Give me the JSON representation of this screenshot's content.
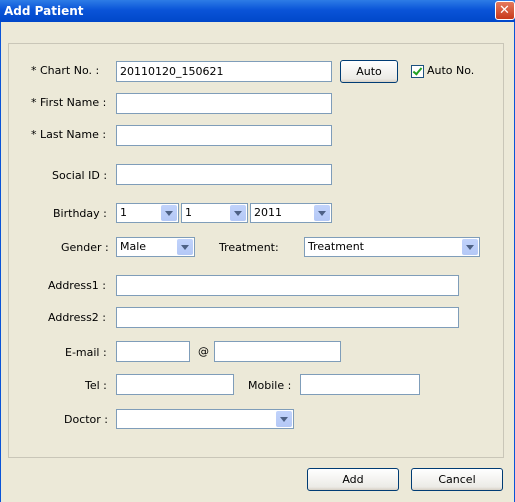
{
  "window": {
    "title": "Add Patient",
    "close_glyph": "✕",
    "close_icon": "close-icon"
  },
  "form": {
    "chart_no": {
      "label": "* Chart No. :",
      "value": "20110120_150621"
    },
    "auto_button": "Auto",
    "auto_no": {
      "label": "Auto No.",
      "checked": true
    },
    "first_name": {
      "label": "* First Name :",
      "value": ""
    },
    "last_name": {
      "label": "* Last Name :",
      "value": ""
    },
    "social_id": {
      "label": "Social ID :",
      "value": ""
    },
    "birthday": {
      "label": "Birthday :",
      "day": "1",
      "month": "1",
      "year": "2011"
    },
    "gender": {
      "label": "Gender :",
      "value": "Male"
    },
    "treatment": {
      "label": "Treatment:",
      "value": "Treatment"
    },
    "address1": {
      "label": "Address1 :",
      "value": ""
    },
    "address2": {
      "label": "Address2 :",
      "value": ""
    },
    "email": {
      "label": "E-mail :",
      "at": "@",
      "user": "",
      "domain": ""
    },
    "tel": {
      "label": "Tel :",
      "value": ""
    },
    "mobile": {
      "label": "Mobile :",
      "value": ""
    },
    "doctor": {
      "label": "Doctor :",
      "value": ""
    }
  },
  "buttons": {
    "add": "Add",
    "cancel": "Cancel"
  }
}
